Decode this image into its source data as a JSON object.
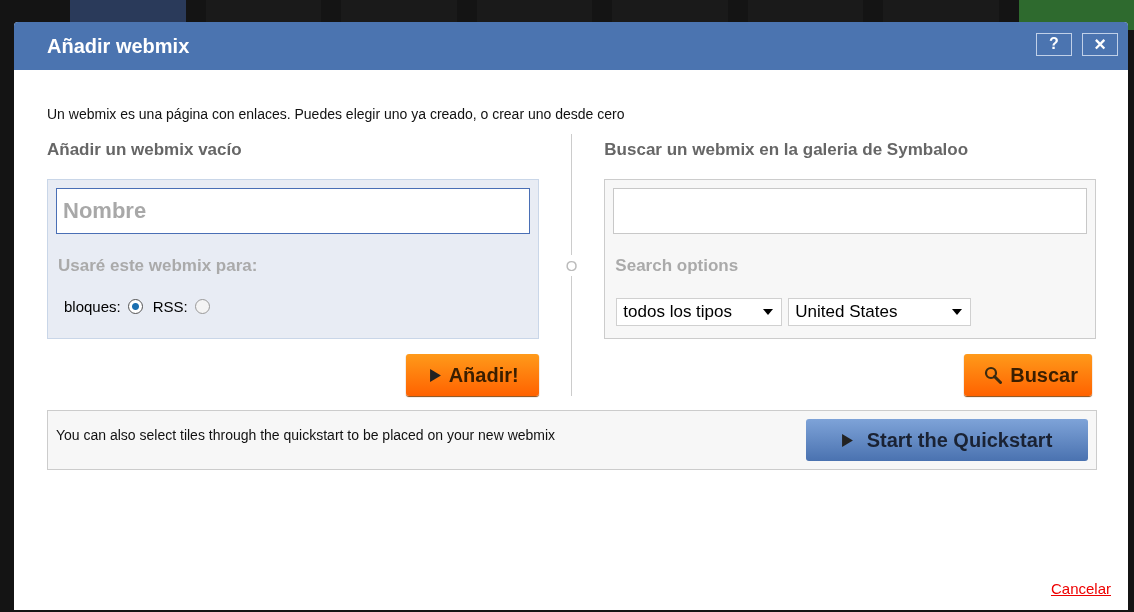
{
  "dialog": {
    "title": "Añadir webmix",
    "header_buttons": [
      {
        "kind": "help",
        "label": "?"
      },
      {
        "kind": "close",
        "label": "×"
      }
    ]
  },
  "intro": "Un webmix es una página con enlaces. Puedes elegir uno ya creado, o crear uno desde cero",
  "create_panel": {
    "heading": "Añadir un webmix vacío",
    "name_field": {
      "placeholder": "Nombre"
    },
    "usage_label": "Usaré este webmix para:",
    "options": [
      {
        "label": "bloques:",
        "selected": true
      },
      {
        "label": "RSS:",
        "selected": false
      }
    ],
    "button": "Añadir!"
  },
  "separator": "O",
  "search_panel": {
    "heading": "Buscar un webmix en la galeria de Symbaloo",
    "options_label": "Search options",
    "selects": [
      {
        "value": "todos los tipos"
      },
      {
        "value": "United States"
      }
    ],
    "button": "Buscar"
  },
  "quickstart": {
    "text": "You can also select tiles through the quickstart to be placed on your new webmix",
    "button": "Start the Quickstart"
  },
  "cancel_link": "Cancelar"
}
